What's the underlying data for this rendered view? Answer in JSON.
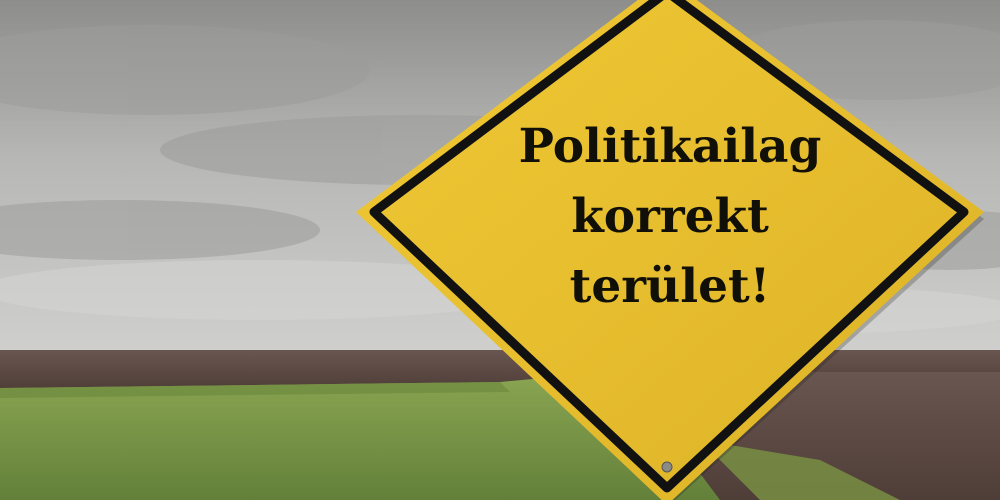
{
  "sign": {
    "lines": [
      "Politikailag",
      "korrekt",
      "terület!"
    ],
    "colors": {
      "face": "#e9bf2e",
      "border": "#111111",
      "text": "#111008"
    }
  },
  "scene": {
    "colors": {
      "sky": "#bdbdbb",
      "soil": "#5f4a44",
      "grass": "#7c9a44"
    }
  }
}
